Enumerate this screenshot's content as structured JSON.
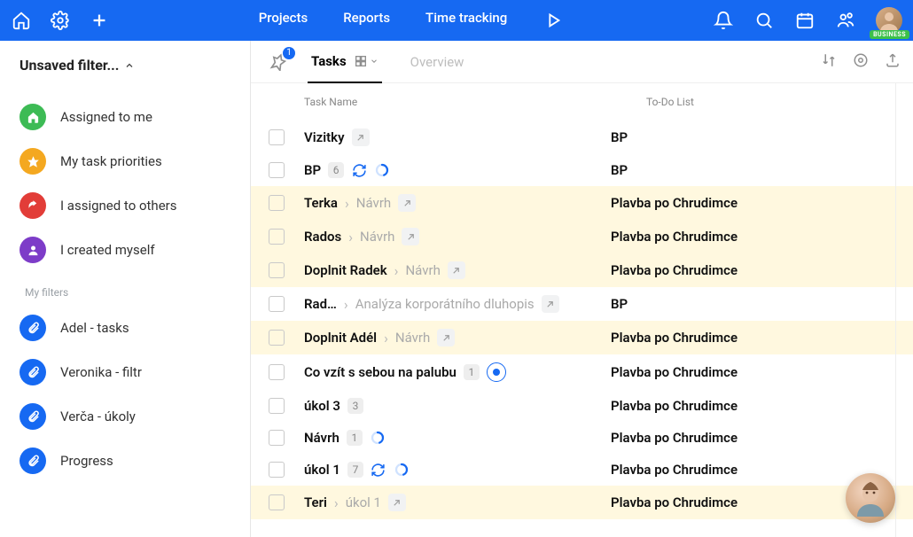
{
  "topnav": {
    "tabs": [
      "Projects",
      "Reports",
      "Time tracking"
    ]
  },
  "avatar_badge": "BUSINESS",
  "filter_title": "Unsaved filter...",
  "smart_filters": [
    {
      "label": "Assigned to me",
      "color": "c-green",
      "icon": "home"
    },
    {
      "label": "My task priorities",
      "color": "c-orange",
      "icon": "star"
    },
    {
      "label": "I assigned to others",
      "color": "c-red",
      "icon": "share"
    },
    {
      "label": "I created myself",
      "color": "c-purple",
      "icon": "user"
    }
  ],
  "myfilters_label": "My filters",
  "my_filters": [
    {
      "label": "Adel - tasks"
    },
    {
      "label": "Veronika - filtr"
    },
    {
      "label": "Verča - úkoly"
    },
    {
      "label": "Progress"
    }
  ],
  "pin_count": "1",
  "content_tabs": {
    "tasks": "Tasks",
    "overview": "Overview"
  },
  "columns": {
    "name": "Task Name",
    "list": "To-Do List"
  },
  "rows": [
    {
      "hl": false,
      "title": "Vizitky",
      "sub": null,
      "count": null,
      "recur": false,
      "donut": false,
      "status": false,
      "link": true,
      "list": "BP"
    },
    {
      "hl": false,
      "title": "BP",
      "sub": null,
      "count": "6",
      "recur": true,
      "donut": true,
      "status": false,
      "link": false,
      "list": "BP"
    },
    {
      "hl": true,
      "title": "Terka",
      "sub": "Návrh",
      "count": null,
      "recur": false,
      "donut": false,
      "status": false,
      "link": true,
      "list": "Plavba po Chrudimce"
    },
    {
      "hl": true,
      "title": "Rados",
      "sub": "Návrh",
      "count": null,
      "recur": false,
      "donut": false,
      "status": false,
      "link": true,
      "list": "Plavba po Chrudimce"
    },
    {
      "hl": true,
      "title": "Doplnit Radek",
      "sub": "Návrh",
      "count": null,
      "recur": false,
      "donut": false,
      "status": false,
      "link": true,
      "list": "Plavba po Chrudimce"
    },
    {
      "hl": false,
      "title": "Rad…",
      "sub": "Analýza korporátního dluhopis",
      "count": null,
      "recur": false,
      "donut": false,
      "status": false,
      "link": true,
      "list": "BP"
    },
    {
      "hl": true,
      "title": "Doplnit Adél",
      "sub": "Návrh",
      "count": null,
      "recur": false,
      "donut": false,
      "status": false,
      "link": true,
      "list": "Plavba po Chrudimce"
    },
    {
      "hl": false,
      "title": "Co vzít s sebou na palubu",
      "sub": null,
      "count": "1",
      "recur": false,
      "donut": false,
      "status": true,
      "link": false,
      "list": "Plavba po Chrudimce"
    },
    {
      "hl": false,
      "title": "úkol 3",
      "sub": null,
      "count": "3",
      "recur": false,
      "donut": false,
      "status": false,
      "link": false,
      "list": "Plavba po Chrudimce"
    },
    {
      "hl": false,
      "title": "Návrh",
      "sub": null,
      "count": "1",
      "recur": false,
      "donut": true,
      "status": false,
      "link": false,
      "list": "Plavba po Chrudimce"
    },
    {
      "hl": false,
      "title": "úkol 1",
      "sub": null,
      "count": "7",
      "recur": true,
      "donut": true,
      "status": false,
      "link": false,
      "list": "Plavba po Chrudimce"
    },
    {
      "hl": true,
      "title": "Teri",
      "sub": "úkol 1",
      "count": null,
      "recur": false,
      "donut": false,
      "status": false,
      "link": true,
      "list": "Plavba po Chrudimce"
    }
  ]
}
